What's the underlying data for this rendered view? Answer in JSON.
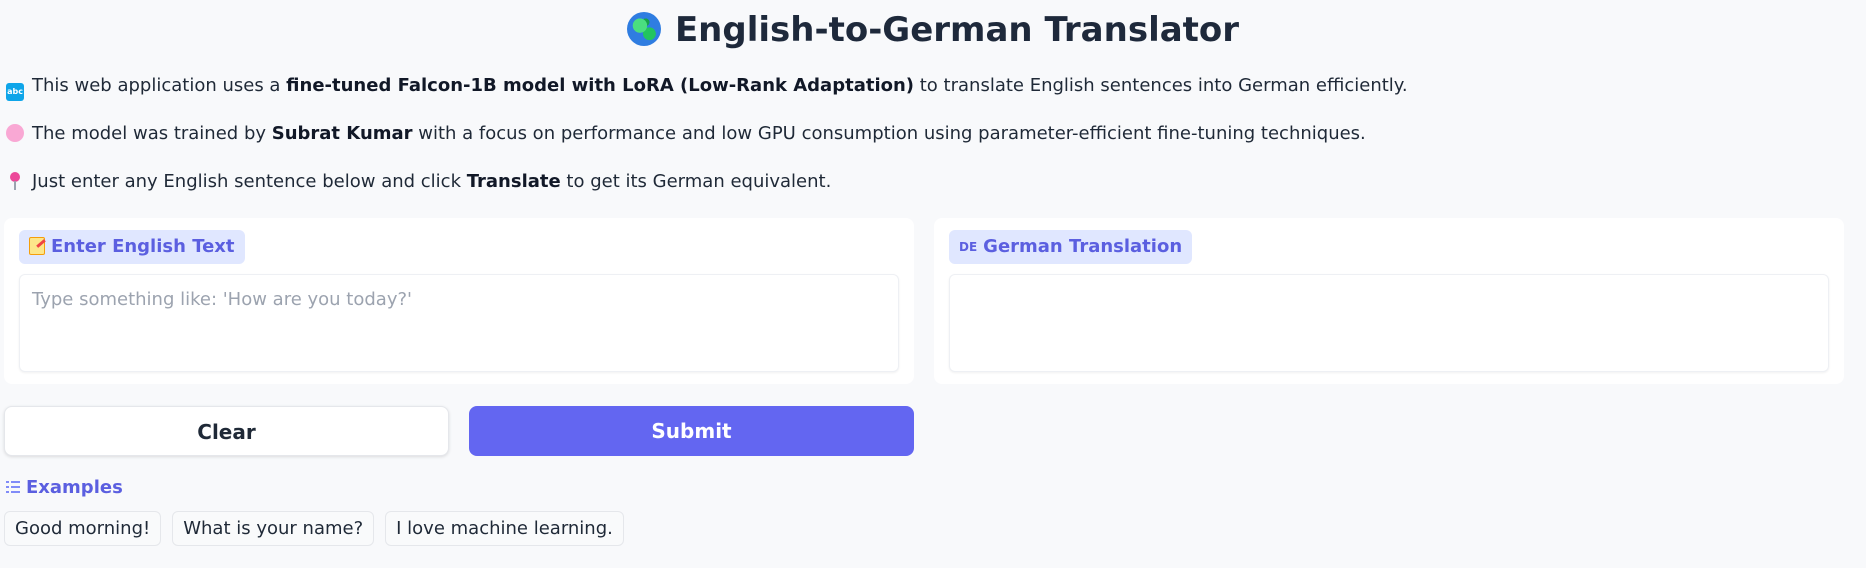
{
  "header": {
    "title": "English-to-German Translator",
    "icon": "globe-icon"
  },
  "description": {
    "line1": {
      "icon": "abc-icon",
      "pre": "This web application uses a ",
      "bold": "fine-tuned Falcon-1B model with LoRA (Low-Rank Adaptation)",
      "post": " to translate English sentences into German efficiently."
    },
    "line2": {
      "icon": "brain-icon",
      "pre": "The model was trained by ",
      "bold": "Subrat Kumar",
      "post": " with a focus on performance and low GPU consumption using parameter-efficient fine-tuning techniques."
    },
    "line3": {
      "icon": "pushpin-icon",
      "pre": "Just enter any English sentence below and click ",
      "bold": "Translate",
      "post": " to get its German equivalent."
    }
  },
  "input_panel": {
    "label": "Enter English Text",
    "icon": "memo-icon",
    "value": "",
    "placeholder": "Type something like: 'How are you today?'"
  },
  "output_panel": {
    "label": "German Translation",
    "icon_text": "DE",
    "value": ""
  },
  "buttons": {
    "clear_label": "Clear",
    "submit_label": "Submit"
  },
  "examples": {
    "heading": "Examples",
    "items": [
      "Good morning!",
      "What is your name?",
      "I love machine learning."
    ]
  },
  "colors": {
    "accent": "#6366f1",
    "label_bg": "#e0e7ff",
    "page_bg": "#f8f9fb"
  }
}
